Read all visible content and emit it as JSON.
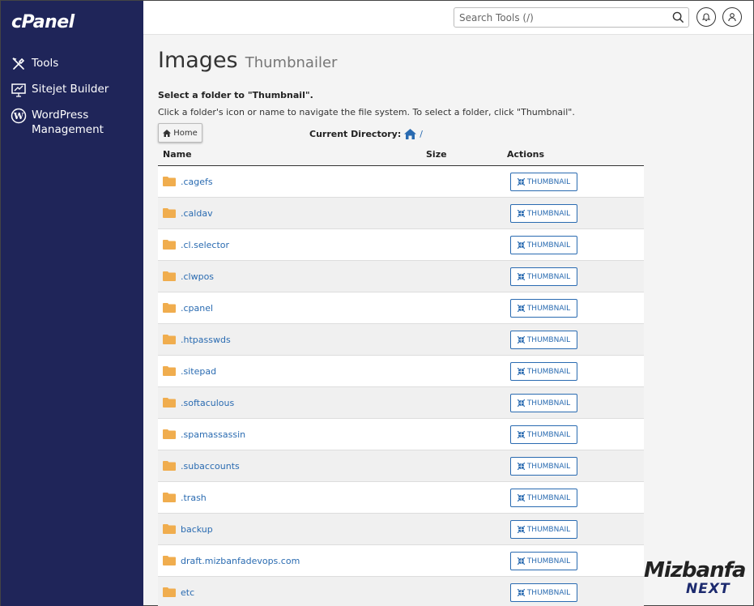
{
  "sidebar": {
    "logo": "cPanel",
    "items": [
      {
        "label": "Tools",
        "icon": "tools-icon"
      },
      {
        "label": "Sitejet Builder",
        "icon": "monitor-icon"
      },
      {
        "label": "WordPress Management",
        "icon": "wordpress-icon"
      }
    ]
  },
  "topbar": {
    "search_placeholder": "Search Tools (/)",
    "search_icon": "search-icon",
    "notifications_icon": "bell-icon",
    "user_icon": "user-icon"
  },
  "page": {
    "title": "Images",
    "subtitle": "Thumbnailer",
    "instruction_bold": "Select a folder to \"Thumbnail\".",
    "instruction": "Click a folder's icon or name to navigate the file system. To select a folder, click \"Thumbnail\".",
    "home_button": "Home",
    "current_directory_label": "Current Directory:",
    "current_directory_path": "/"
  },
  "table": {
    "headers": {
      "name": "Name",
      "size": "Size",
      "actions": "Actions"
    },
    "action_label": "THUMBNAIL",
    "rows": [
      ".cagefs",
      ".caldav",
      ".cl.selector",
      ".clwpos",
      ".cpanel",
      ".htpasswds",
      ".sitepad",
      ".softaculous",
      ".spamassassin",
      ".subaccounts",
      ".trash",
      "backup",
      "draft.mizbanfadevops.com",
      "etc"
    ]
  },
  "watermark": {
    "line1": "Mizbanfa",
    "line2": "NEXT"
  },
  "colors": {
    "sidebar": "#1f2559",
    "link": "#2a6bb1",
    "folder": "#f0ad4e"
  }
}
